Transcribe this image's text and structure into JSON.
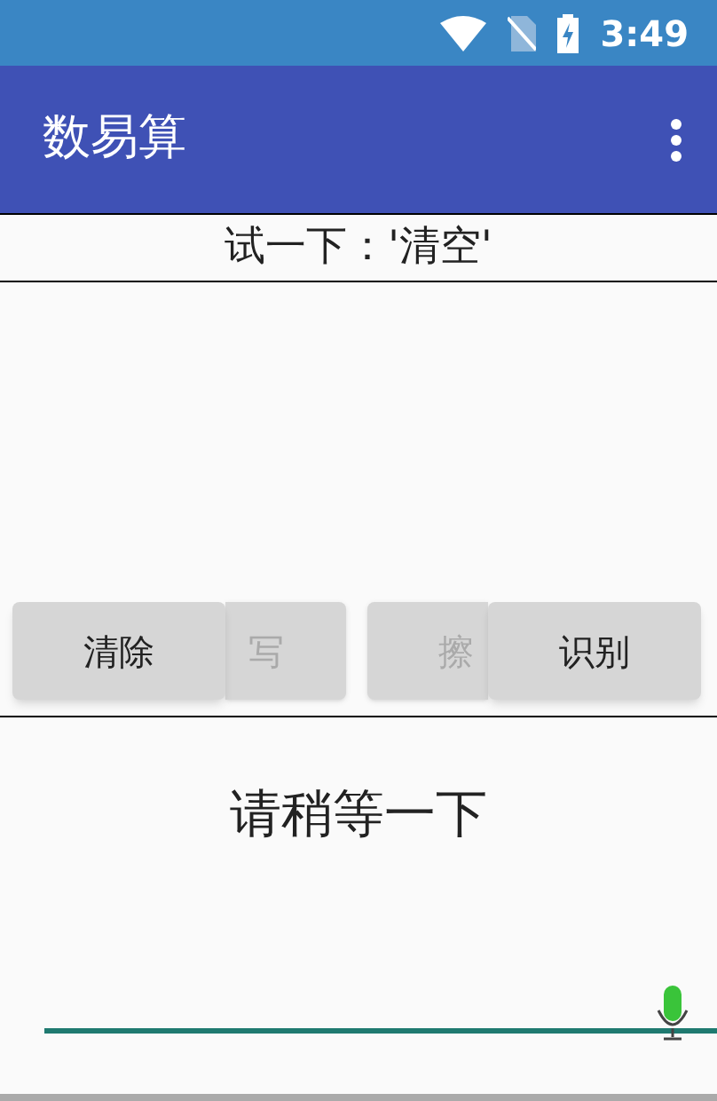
{
  "status_bar": {
    "time": "3:49"
  },
  "app_bar": {
    "title": "数易算"
  },
  "prompt": "试一下：'清空'",
  "buttons": [
    {
      "label": "清除",
      "kind": "front"
    },
    {
      "label": "写",
      "kind": "covered"
    },
    {
      "label": "擦",
      "kind": "covered"
    },
    {
      "label": "识别",
      "kind": "front"
    }
  ],
  "message": "请稍等一下"
}
